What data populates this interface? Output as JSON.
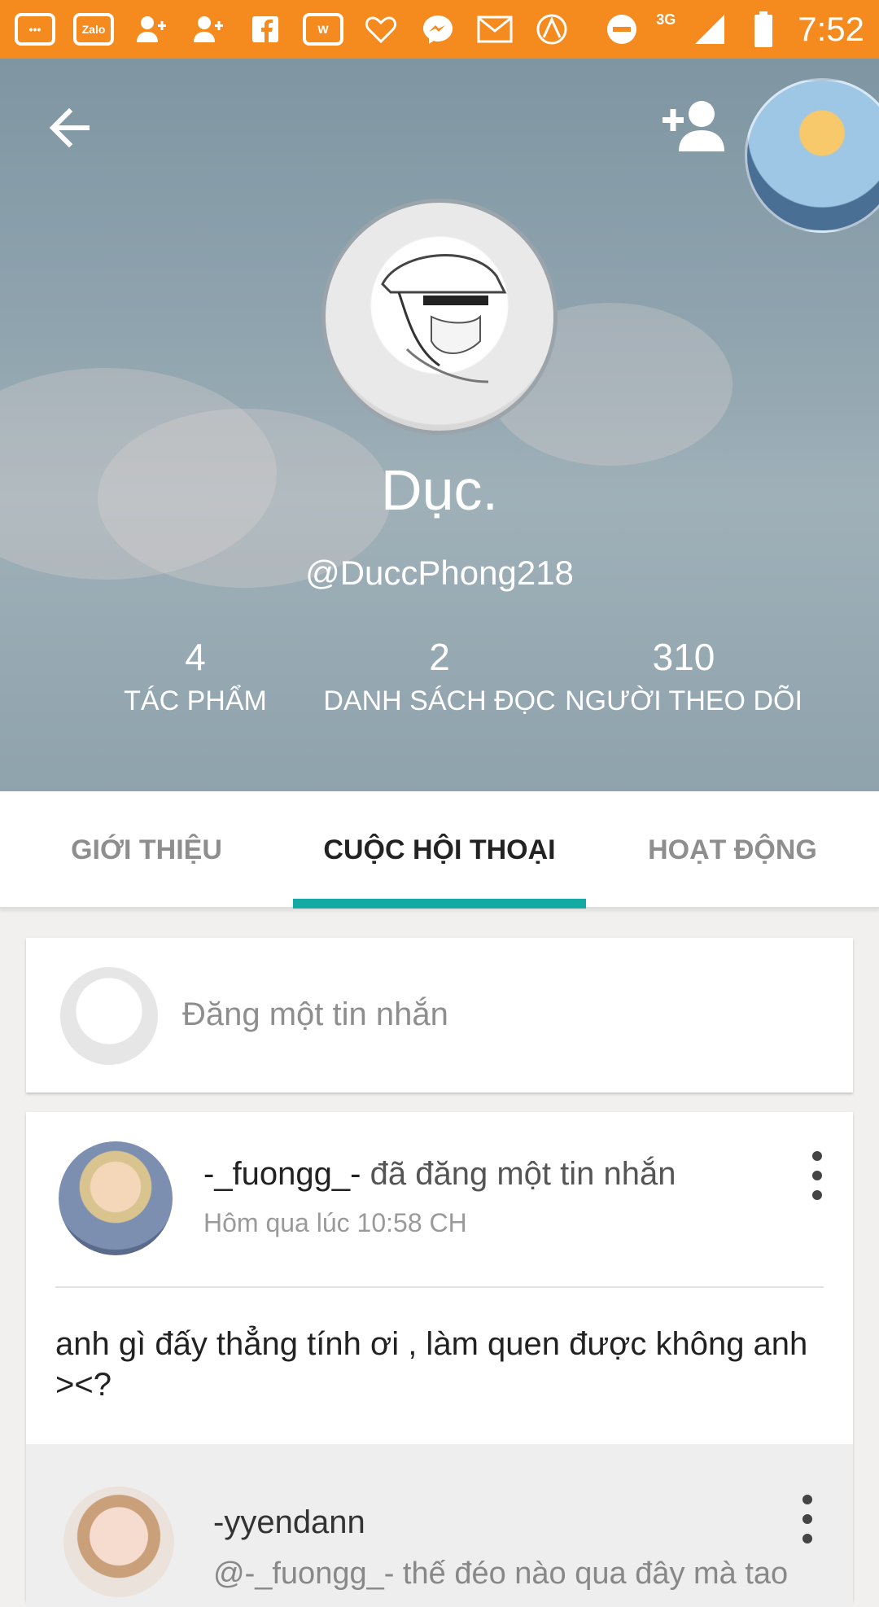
{
  "status_bar": {
    "time": "7:52",
    "network": "3G",
    "notification_icons": [
      "chat-bubble-icon",
      "zalo-icon",
      "add-user-icon",
      "add-user-icon",
      "facebook-icon",
      "wattpad-icon",
      "messenger-icon",
      "gmail-icon",
      "arrow-app-icon"
    ],
    "zalo_label": "Zalo"
  },
  "header": {
    "display_name": "Dục.",
    "username": "@DuccPhong218",
    "stats": [
      {
        "value": "4",
        "label": "TÁC PHẨM"
      },
      {
        "value": "2",
        "label": "DANH SÁCH ĐỌC"
      },
      {
        "value": "310",
        "label": "NGƯỜI THEO DÕI"
      }
    ]
  },
  "tabs": [
    {
      "label": "GIỚI THIỆU",
      "active": false
    },
    {
      "label": "CUỘC HỘI THOẠI",
      "active": true
    },
    {
      "label": "HOẠT ĐỘNG",
      "active": false
    }
  ],
  "compose": {
    "placeholder": "Đăng một tin nhắn"
  },
  "post": {
    "username": "-_fuongg_-",
    "action": "đã đăng một tin nhắn",
    "time": "Hôm qua lúc 10:58 CH",
    "message": "anh gì đấy thẳng tính ơi , làm quen được không anh ><?"
  },
  "reply": {
    "username": "-yyendann",
    "snippet": "@-_fuongg_- thế đéo nào qua đây mà tao"
  },
  "colors": {
    "status_bar": "#f58a1f",
    "tab_accent": "#14a9a3"
  }
}
